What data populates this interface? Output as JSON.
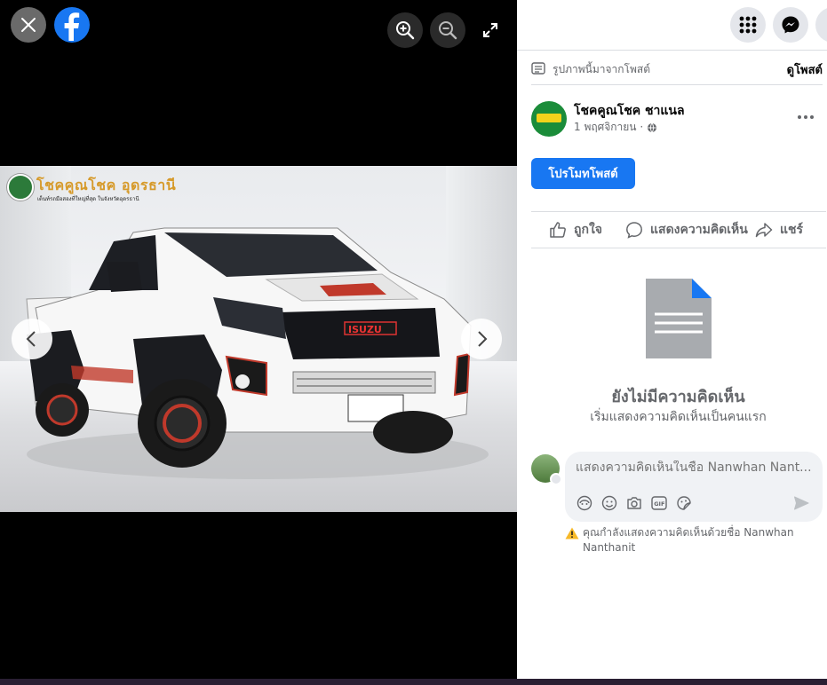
{
  "viewer": {
    "close_label": "Close",
    "brand": "facebook",
    "photo": {
      "dealer_name": "โชคคูณโชค อุดรธานี",
      "dealer_tagline": "เต็นท์รถมือสองที่ใหญ่ที่สุด ในจังหวัดอุดรธานี"
    }
  },
  "panel": {
    "source_text": "รูปภาพนี้มาจากโพสต์",
    "view_post": "ดูโพสต์",
    "page_name": "โชคคูณโชค ชาแนล",
    "post_date": "1 พฤศจิกายน ·",
    "promote_label": "โปรโมทโพสต์",
    "actions": {
      "like": "ถูกใจ",
      "comment": "แสดงความคิดเห็น",
      "share": "แชร์"
    },
    "empty": {
      "title": "ยังไม่มีความคิดเห็น",
      "subtitle": "เริ่มแสดงความคิดเห็นเป็นคนแรก"
    },
    "comment_placeholder": "แสดงความคิดเห็นในชื่อ Nanwhan Nant...",
    "warning": "คุณกำลังแสดงความคิดเห็นด้วยชื่อ Nanwhan Nanthanit"
  },
  "colors": {
    "brand_blue": "#1877f2",
    "muted_text": "#65676b",
    "warning_yellow": "#f7b928"
  }
}
